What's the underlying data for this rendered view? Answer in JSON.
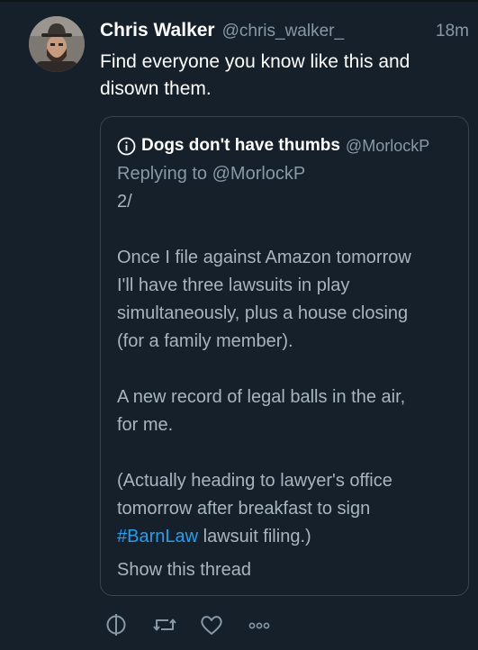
{
  "tweet": {
    "author_name": "Chris Walker",
    "author_handle": "@chris_walker_",
    "time": "18m",
    "text_lines": [
      "Find everyone you know like this and",
      "disown them."
    ],
    "avatar_icon": "avatar-photo"
  },
  "quote": {
    "info_icon": "info-icon",
    "author_name": "Dogs don't have thumbs",
    "author_handle": "@MorlockP",
    "replying_to": "Replying to @MorlockP",
    "lines": [
      "2/",
      "",
      "Once I file against Amazon tomorrow",
      "I'll have three lawsuits in play",
      "simultaneously, plus a house closing",
      "(for a family member).",
      "",
      "A new record of legal balls in the air,",
      "for me.",
      "",
      "(Actually heading to lawyer's office",
      "tomorrow after breakfast to sign"
    ],
    "last_line_hashtag": "#BarnLaw",
    "last_line_rest": " lawsuit filing.)",
    "show_thread": "Show this thread"
  },
  "actions": [
    {
      "name": "reply",
      "icon": "reply-icon"
    },
    {
      "name": "retweet",
      "icon": "retweet-icon"
    },
    {
      "name": "like",
      "icon": "heart-icon"
    },
    {
      "name": "more",
      "icon": "more-icon"
    }
  ],
  "colors": {
    "background": "#15202b",
    "secondary_text": "#8899a6",
    "quoted_text": "#a8b4be",
    "border": "#38444d",
    "link": "#1da1f2"
  }
}
